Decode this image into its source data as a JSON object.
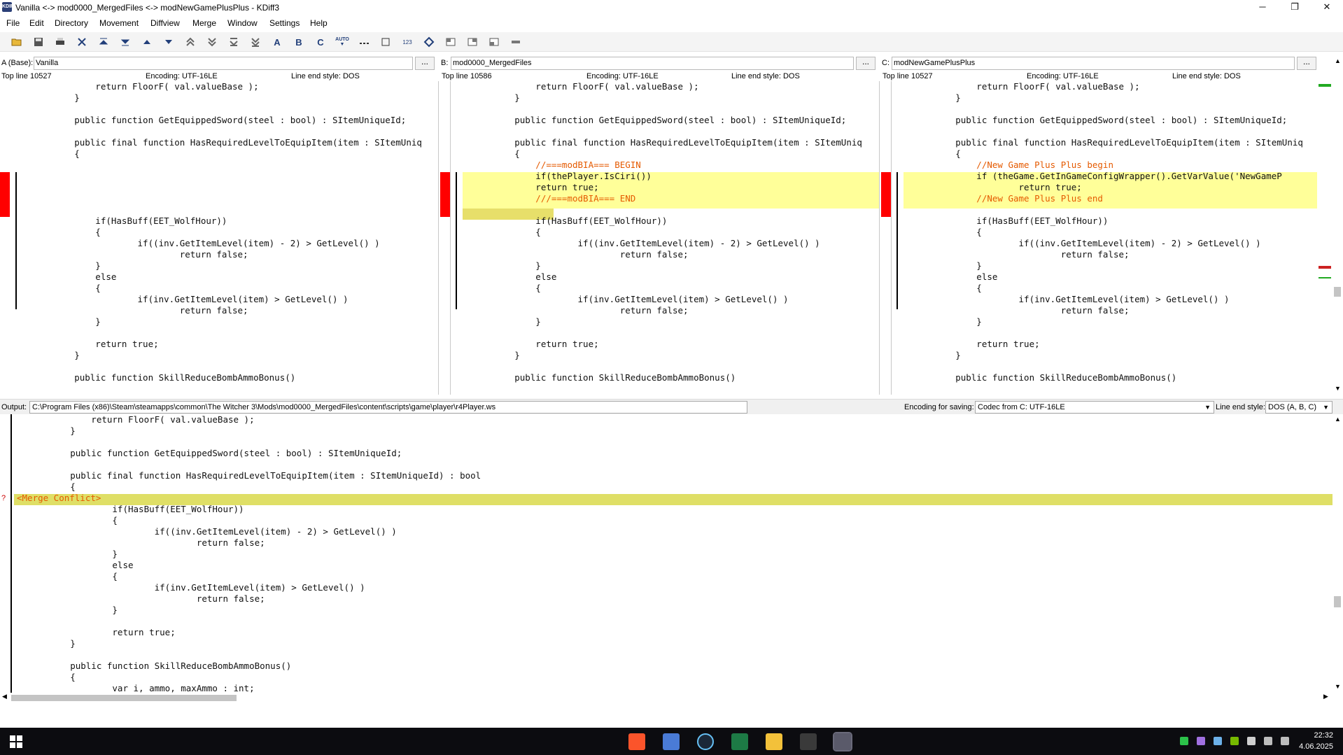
{
  "window": {
    "title": "Vanilla <-> mod0000_MergedFiles <-> modNewGamePlusPlus - KDiff3",
    "app_icon_text": "KDIFF",
    "buttons": {
      "minimize": "─",
      "maximize": "❐",
      "close": "✕"
    }
  },
  "menu": [
    "File",
    "Edit",
    "Directory",
    "Movement",
    "Diffview",
    "Merge",
    "Window",
    "Settings",
    "Help"
  ],
  "toolbar": {
    "icons": [
      "open-folder-icon",
      "save-icon",
      "print-icon",
      "go-top-icon",
      "go-first-delta-icon",
      "go-prev-unsolved-icon",
      "go-prev-delta-icon",
      "go-next-delta-icon",
      "go-prev-conflict-icon",
      "go-next-conflict-icon",
      "go-last-delta-icon",
      "go-bottom-icon"
    ],
    "choose_a": "A",
    "choose_b": "B",
    "choose_c": "C",
    "auto_label": "AUTO",
    "line_numbers_label": "123"
  },
  "panes": [
    {
      "id": "A",
      "label": "A (Base):",
      "file": "Vanilla",
      "browse": "...",
      "top_line": "Top line 10527",
      "encoding": "Encoding: UTF-16LE",
      "line_end": "Line end style: DOS"
    },
    {
      "id": "B",
      "label": "B:",
      "file": "mod0000_MergedFiles",
      "browse": "...",
      "top_line": "Top line 10586",
      "encoding": "Encoding: UTF-16LE",
      "line_end": "Line end style: DOS"
    },
    {
      "id": "C",
      "label": "C:",
      "file": "modNewGamePlusPlus",
      "browse": "...",
      "top_line": "Top line 10527",
      "encoding": "Encoding: UTF-16LE",
      "line_end": "Line end style: DOS"
    }
  ],
  "code": {
    "common_before": [
      "            return FloorF( val.valueBase );",
      "        }",
      "",
      "        public function GetEquippedSword(steel : bool) : SItemUniqueId;",
      "",
      "        public final function HasRequiredLevelToEquipItem(item : SItemUniq",
      "        {"
    ],
    "a_inserted": [
      "",
      "",
      "",
      "",
      ""
    ],
    "b_inserted": [
      "            //===modBIA=== BEGIN",
      "            if(thePlayer.IsCiri())",
      "            return true;",
      "            ///===modBIA=== END",
      ""
    ],
    "c_inserted": [
      "            //New Game Plus Plus begin",
      "            if (theGame.GetInGameConfigWrapper().GetVarValue('NewGameP",
      "                    return true;",
      "            //New Game Plus Plus end",
      ""
    ],
    "common_after": [
      "            if(HasBuff(EET_WolfHour))",
      "            {",
      "                    if((inv.GetItemLevel(item) - 2) > GetLevel() )",
      "                            return false;",
      "            }",
      "            else",
      "            {",
      "                    if(inv.GetItemLevel(item) > GetLevel() )",
      "                            return false;",
      "            }",
      "",
      "            return true;",
      "        }",
      "",
      "        public function SkillReduceBombAmmoBonus()"
    ]
  },
  "output": {
    "label": "Output:",
    "path": "C:\\Program Files (x86)\\Steam\\steamapps\\common\\The Witcher 3\\Mods\\mod0000_MergedFiles\\content\\scripts\\game\\player\\r4Player.ws",
    "encoding_label": "Encoding for saving:",
    "encoding_value": "Codec from C: UTF-16LE",
    "line_end_label": "Line end style:",
    "line_end_value": "DOS (A, B, C)"
  },
  "merge": {
    "conflict_marker": "?",
    "lines": [
      "            return FloorF( val.valueBase );",
      "        }",
      "",
      "        public function GetEquippedSword(steel : bool) : SItemUniqueId;",
      "",
      "        public final function HasRequiredLevelToEquipItem(item : SItemUniqueId) : bool",
      "        {",
      "<Merge Conflict>",
      "                if(HasBuff(EET_WolfHour))",
      "                {",
      "                        if((inv.GetItemLevel(item) - 2) > GetLevel() )",
      "                                return false;",
      "                }",
      "                else",
      "                {",
      "                        if(inv.GetItemLevel(item) > GetLevel() )",
      "                                return false;",
      "                }",
      "",
      "                return true;",
      "        }",
      "",
      "        public function SkillReduceBombAmmoBonus()",
      "        {",
      "                var i, ammo, maxAmmo : int;"
    ]
  },
  "taskbar": {
    "time": "22:32",
    "date": "4.06.2025",
    "apps": [
      "brave-browser-icon",
      "app-icon",
      "steam-icon",
      "excel-like-icon",
      "file-explorer-icon",
      "spider-app-icon",
      "kdiff3-icon"
    ]
  },
  "colors": {
    "diff_insert_bg": "#ffff99",
    "conflict_bg": "#dfdf66",
    "delta_marker": "#ff0000",
    "comment_text": "#e55a00"
  }
}
